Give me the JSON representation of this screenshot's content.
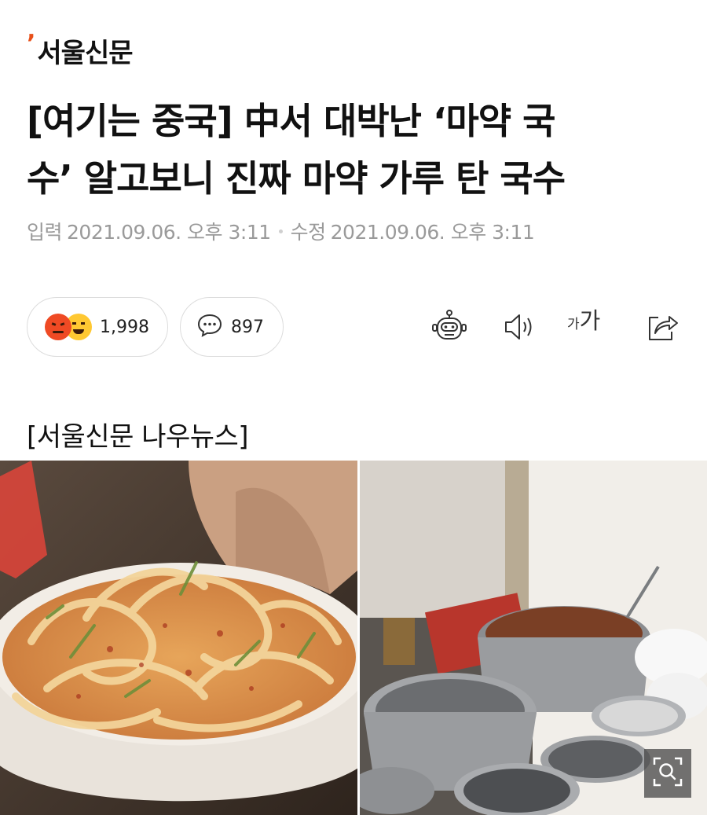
{
  "brand": {
    "name": "서울신문",
    "accent": "#e8501a"
  },
  "article": {
    "title_line1": "[여기는 중국] 中서 대박난 ‘마약 국",
    "title_line2": "수’ 알고보니 진짜 마약 가루 탄 국수",
    "input_label": "입력",
    "input_date": "2021.09.06. 오후 3:11",
    "modified_label": "수정",
    "modified_date": "2021.09.06. 오후 3:11",
    "caption": "[서울신문 나우뉴스]"
  },
  "reactions": {
    "count": "1,998",
    "emojis": [
      "angry-emoji",
      "laugh-emoji"
    ]
  },
  "comments": {
    "count": "897"
  },
  "toolbar": {
    "icons": [
      "robot-icon",
      "speaker-icon",
      "font-size-icon",
      "share-icon"
    ],
    "font_small": "가",
    "font_big": "가"
  },
  "photos": [
    "noodle-dish-photo",
    "kitchen-pots-photo"
  ],
  "colors": {
    "meta_text": "#9a9a9a",
    "border": "#dcdcdc",
    "angry": "#ef4a24",
    "laugh": "#ffc832"
  }
}
